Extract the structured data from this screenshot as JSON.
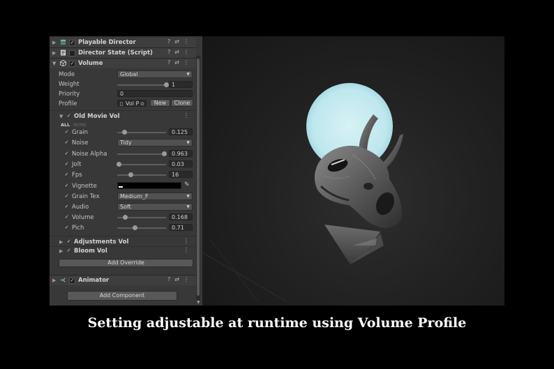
{
  "components": {
    "playable_director": {
      "label": "Playable Director",
      "checked": true
    },
    "director_state": {
      "label": "Director State (Script)",
      "checked": false
    },
    "volume": {
      "label": "Volume",
      "checked": true
    },
    "animator": {
      "label": "Animator",
      "checked": true
    }
  },
  "header_buttons": {
    "help": "?",
    "presets": "⇄",
    "menu": "⋮"
  },
  "volume": {
    "mode_label": "Mode",
    "mode_value": "Global",
    "weight_label": "Weight",
    "weight_value": "1",
    "weight_fraction": 1.0,
    "priority_label": "Priority",
    "priority_value": "0",
    "profile_label": "Profile",
    "profile_value": "Vol P",
    "new_button": "New",
    "clone_button": "Clone"
  },
  "overrides": {
    "old_movie": {
      "label": "Old Movie Vol",
      "checked": true
    },
    "all_label": "ALL",
    "none_label": "NONE",
    "adjustments": {
      "label": "Adjustments Vol",
      "checked": true
    },
    "bloom": {
      "label": "Bloom Vol",
      "checked": true
    },
    "add_override": "Add Override"
  },
  "params": [
    {
      "label": "Grain",
      "type": "slider",
      "value": "0.125",
      "fraction": 0.15
    },
    {
      "label": "Noise",
      "type": "dropdown",
      "value": "Tidy"
    },
    {
      "label": "Noise Alpha",
      "type": "slider",
      "value": "0.963",
      "fraction": 0.96
    },
    {
      "label": "Jolt",
      "type": "slider",
      "value": "0.03",
      "fraction": 0.03
    },
    {
      "label": "Fps",
      "type": "slider",
      "value": "16",
      "fraction": 0.28
    },
    {
      "label": "Vignette",
      "type": "color",
      "value": ""
    },
    {
      "label": "Grain Tex",
      "type": "dropdown",
      "value": "Medium_F"
    },
    {
      "label": "Audio",
      "type": "dropdown",
      "value": "Soft"
    },
    {
      "label": "Volume",
      "type": "slider",
      "value": "0.168",
      "fraction": 0.17
    },
    {
      "label": "Pich",
      "type": "slider",
      "value": "0.71",
      "fraction": 0.36
    }
  ],
  "add_component": "Add Component",
  "caption": "Setting adjustable at runtime using Volume Profile",
  "colors": {
    "panel_bg": "#383838",
    "moon": "#bfe7ee",
    "viewport_bg": "#222222"
  }
}
